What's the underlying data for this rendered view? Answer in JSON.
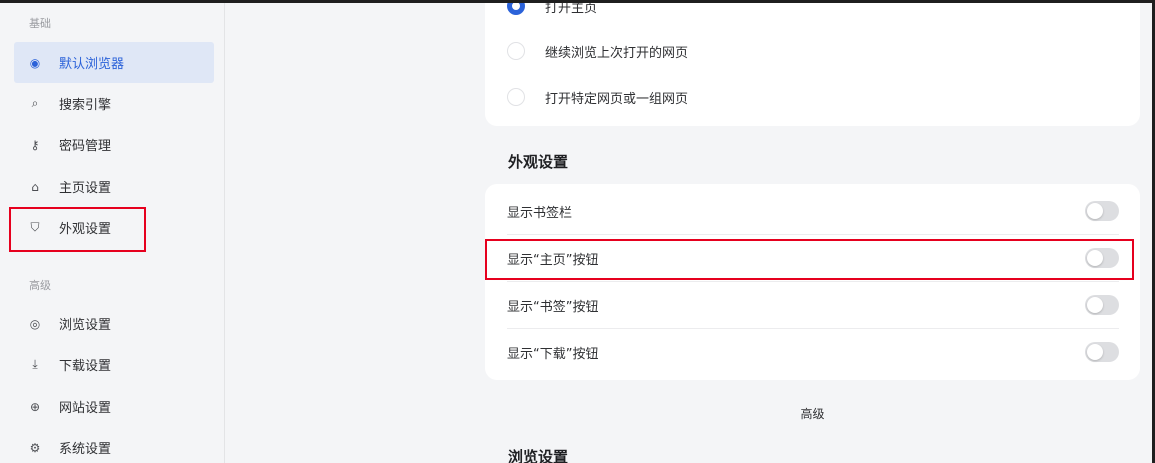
{
  "sidebar": {
    "section_basic": "基础",
    "section_advanced": "高级",
    "items": [
      {
        "label": "默认浏览器",
        "icon": "globe-icon",
        "glyph": "◉",
        "active": true
      },
      {
        "label": "搜索引擎",
        "icon": "search-icon",
        "glyph": "⌕"
      },
      {
        "label": "密码管理",
        "icon": "key-icon",
        "glyph": "⚷"
      },
      {
        "label": "主页设置",
        "icon": "home-icon",
        "glyph": "⌂"
      },
      {
        "label": "外观设置",
        "icon": "brush-icon",
        "glyph": "⛉"
      },
      {
        "label": "浏览设置",
        "icon": "eye-icon",
        "glyph": "◎"
      },
      {
        "label": "下载设置",
        "icon": "download-icon",
        "glyph": "⤓"
      },
      {
        "label": "网站设置",
        "icon": "web-icon",
        "glyph": "⊕"
      },
      {
        "label": "系统设置",
        "icon": "gear-icon",
        "glyph": "⚙"
      }
    ]
  },
  "main": {
    "startup_options": [
      {
        "label": "打开主页",
        "checked": true
      },
      {
        "label": "继续浏览上次打开的网页",
        "checked": false
      },
      {
        "label": "打开特定网页或一组网页",
        "checked": false
      }
    ],
    "appearance_title": "外观设置",
    "appearance_toggles": [
      {
        "label": "显示书签栏",
        "on": false
      },
      {
        "label": "显示“主页”按钮",
        "on": false
      },
      {
        "label": "显示“书签”按钮",
        "on": false
      },
      {
        "label": "显示“下载”按钮",
        "on": false
      }
    ],
    "advanced_label": "高级",
    "browse_title": "浏览设置"
  },
  "colors": {
    "accent": "#2b62d9",
    "highlight": "#e6001e"
  }
}
